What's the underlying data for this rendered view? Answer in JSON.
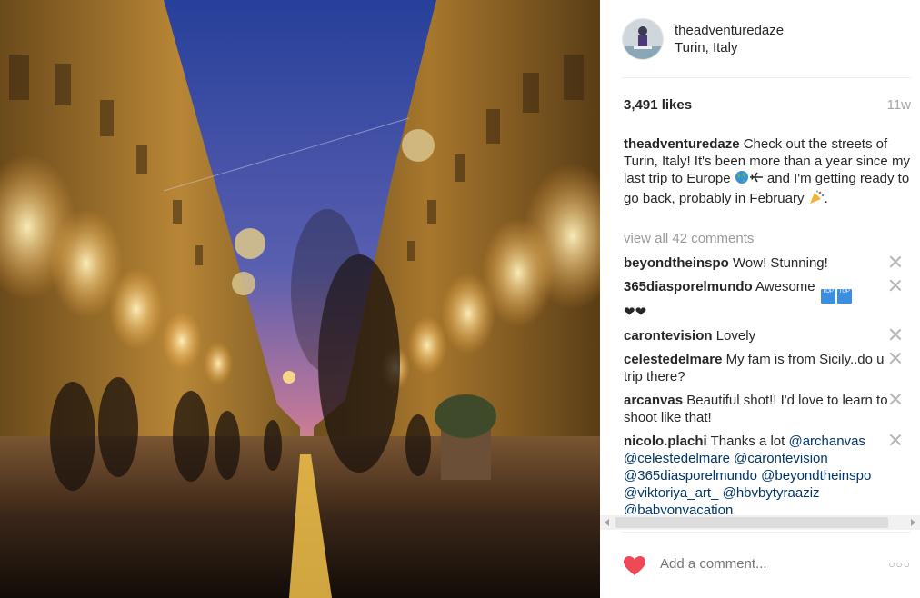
{
  "post": {
    "username": "theadventuredaze",
    "location": "Turin, Italy",
    "likes": "3,491 likes",
    "age": "11w",
    "caption_user": "theadventuredaze",
    "caption_text_1": " Check out the streets of Turin, Italy! It's been more than a year since my last trip to Europe ",
    "caption_text_2": " and I'm getting ready to go back, probably in February ",
    "caption_text_3": ".",
    "view_all": "view all 42 comments"
  },
  "comments": [
    {
      "user": "beyondtheinspo",
      "text": "Wow! Stunning!"
    },
    {
      "user": "365diasporelmundo",
      "text": "Awesome"
    },
    {
      "user": "carontevision",
      "text": "Lovely"
    },
    {
      "user": "celestedelmare",
      "text": "My fam is from Sicily..do u trip there?"
    },
    {
      "user": "arcanvas",
      "text": "Beautiful shot!! I'd love to learn to shoot like that!"
    },
    {
      "user": "nicolo.plachi",
      "text": "Thanks a lot ",
      "mentions": [
        "@archanvas",
        "@celestedelmare",
        "@carontevision",
        "@365diasporelmundo",
        "@beyondtheinspo",
        "@viktoriya_art_",
        "@hbvbytyraaziz",
        "@babyonvacation"
      ]
    }
  ],
  "input": {
    "placeholder": "Add a comment..."
  },
  "emoji": {
    "tag_label": "TOP",
    "hearts": "❤❤"
  },
  "colors": {
    "heart": "#ed4956",
    "link": "#003569",
    "muted": "#999999"
  }
}
